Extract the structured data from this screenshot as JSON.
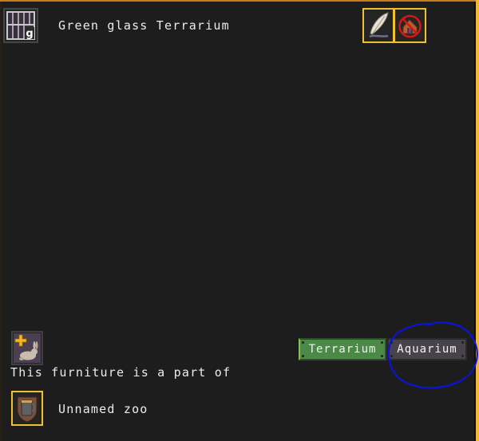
{
  "header": {
    "title": "Green glass Terrarium",
    "item_icon": "cage-icon",
    "item_icon_badge": "g",
    "actions": [
      {
        "name": "rename",
        "icon": "quill-feather-icon"
      },
      {
        "name": "forbid-use",
        "icon": "no-house-icon"
      }
    ]
  },
  "add_animal": {
    "icon": "add-animal-rabbit-icon"
  },
  "part_of": {
    "label": "This furniture is a part of",
    "zone_icon": "zoo-tankard-shield-icon",
    "zone_name": "Unnamed zoo"
  },
  "mode_buttons": [
    {
      "label": "Terrarium",
      "selected": true,
      "color": "#4b8a46"
    },
    {
      "label": "Aquarium",
      "selected": false,
      "color": "#48434a"
    }
  ],
  "annotation": {
    "shape": "hand-drawn circle",
    "target": "Aquarium",
    "color": "#0a14d8"
  },
  "colors": {
    "background": "#1d1d1d",
    "highlight_border": "#f2c12e",
    "text": "#ececec"
  }
}
